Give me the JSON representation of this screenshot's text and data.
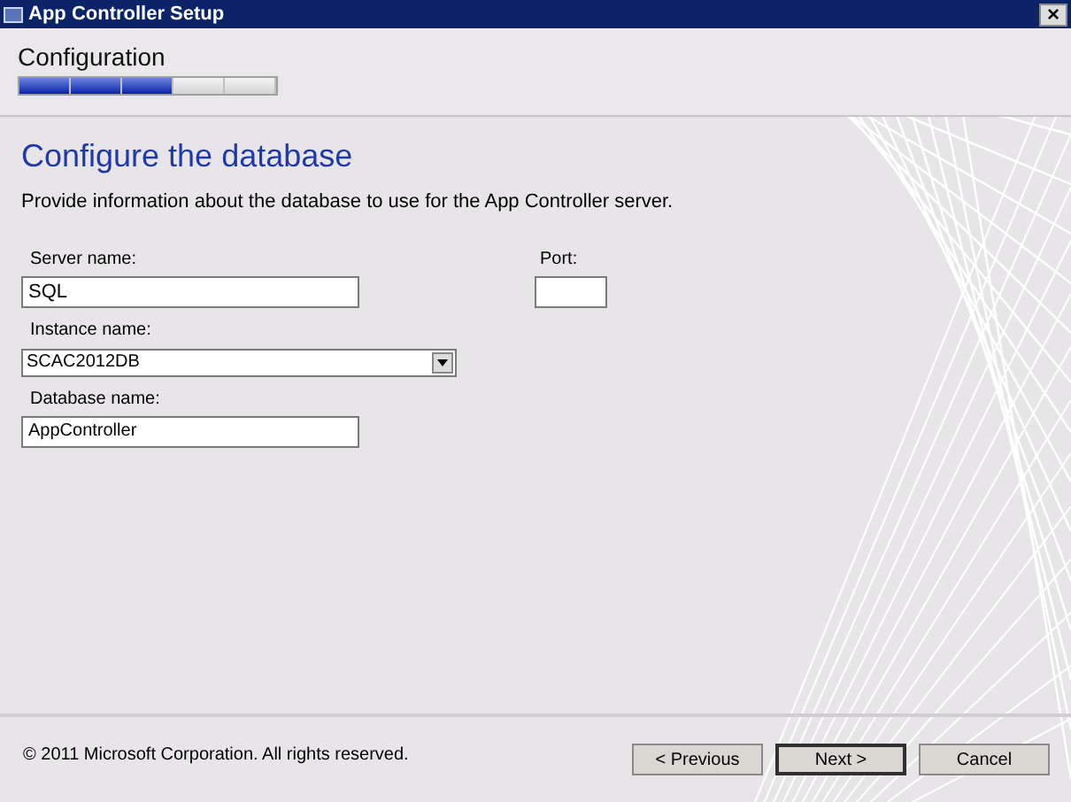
{
  "window": {
    "title": "App Controller Setup",
    "close": "×"
  },
  "header": {
    "title": "Configuration",
    "steps": [
      {
        "completed": true
      },
      {
        "completed": true
      },
      {
        "completed": true
      },
      {
        "completed": false
      },
      {
        "completed": false
      }
    ]
  },
  "page": {
    "heading": "Configure the database",
    "description": "Provide information about the database to use for the App Controller server."
  },
  "fields": {
    "server": {
      "label": "Server name:",
      "value": "SQL"
    },
    "port": {
      "label": "Port:"
    },
    "instance": {
      "label": "Instance name:",
      "value": "SCAC2012DB"
    },
    "database": {
      "label": "Database name:",
      "value": "AppController"
    }
  },
  "footer": {
    "copyright": "© 2011 Microsoft Corporation. All rights reserved.",
    "buttons": [
      {
        "label": "< Previous",
        "default": false
      },
      {
        "label": "Next >",
        "default": true
      },
      {
        "label": "Cancel",
        "default": false
      }
    ]
  }
}
